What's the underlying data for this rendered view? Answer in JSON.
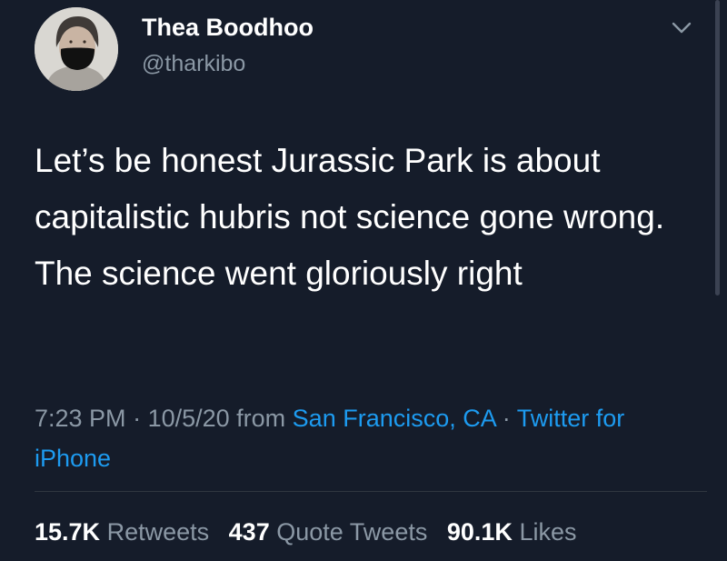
{
  "author": {
    "display_name": "Thea Boodhoo",
    "handle": "@tharkibo"
  },
  "tweet": {
    "text": "Let’s be honest Jurassic Park is about capitalistic hubris not science gone wrong. The science went gloriously right"
  },
  "meta": {
    "time": "7:23 PM",
    "separator_1": " · ",
    "date": "10/5/20",
    "from_label": " from ",
    "location": "San Francisco, CA",
    "separator_2": " · ",
    "source": "Twitter for iPhone"
  },
  "stats": {
    "retweets_count": "15.7K",
    "retweets_label": "Retweets",
    "quote_tweets_count": "437",
    "quote_tweets_label": "Quote Tweets",
    "likes_count": "90.1K",
    "likes_label": "Likes"
  },
  "icons": {
    "menu": "chevron-down-icon",
    "avatar": "avatar"
  },
  "colors": {
    "background": "#151c2a",
    "text": "#ffffff",
    "secondary_text": "#8b98a5",
    "link": "#1d9bf0"
  }
}
